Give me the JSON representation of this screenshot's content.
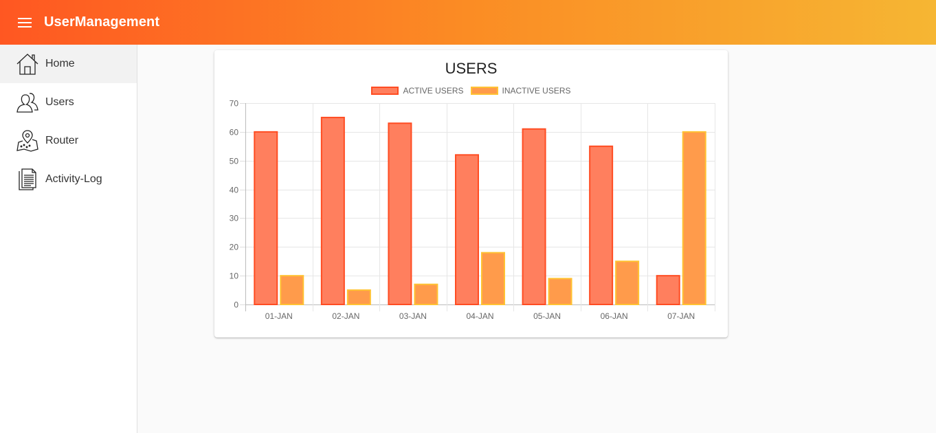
{
  "header": {
    "title": "UserManagement",
    "menu_icon": "menu-icon"
  },
  "sidebar": {
    "items": [
      {
        "label": "Home",
        "icon": "home-icon",
        "active": true
      },
      {
        "label": "Users",
        "icon": "users-icon",
        "active": false
      },
      {
        "label": "Router",
        "icon": "map-pin-icon",
        "active": false
      },
      {
        "label": "Activity-Log",
        "icon": "document-icon",
        "active": false
      }
    ]
  },
  "colors": {
    "header_gradient": [
      "#ff5722",
      "#fb8c24",
      "#f6b633"
    ],
    "active_fill": "#ff7f5e",
    "active_border": "#ff4c22",
    "inactive_fill": "#ff9b4b",
    "inactive_border": "#ffc233"
  },
  "chart_data": {
    "type": "bar",
    "title": "USERS",
    "categories": [
      "01-JAN",
      "02-JAN",
      "03-JAN",
      "04-JAN",
      "05-JAN",
      "06-JAN",
      "07-JAN"
    ],
    "series": [
      {
        "name": "ACTIVE USERS",
        "values": [
          60,
          65,
          63,
          52,
          61,
          55,
          10
        ]
      },
      {
        "name": "INACTIVE USERS",
        "values": [
          10,
          5,
          7,
          18,
          9,
          15,
          60
        ]
      }
    ],
    "ylim": [
      0,
      70
    ],
    "yticks": [
      0,
      10,
      20,
      30,
      40,
      50,
      60,
      70
    ],
    "grid": true,
    "legend_position": "top"
  }
}
